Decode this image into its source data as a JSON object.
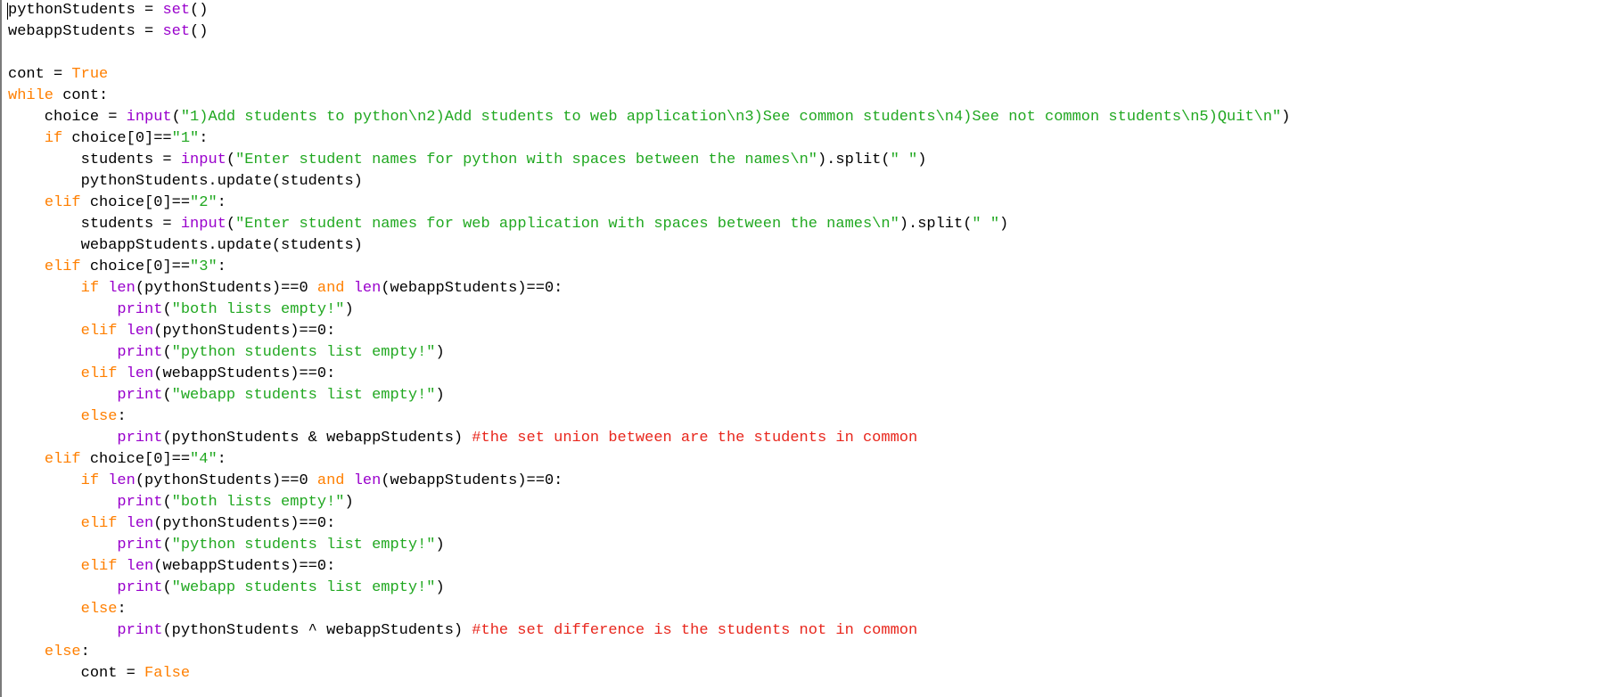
{
  "editor": {
    "colors": {
      "plain": "#000000",
      "keyword": "#ff7f00",
      "builtin": "#9900cc",
      "string": "#21a821",
      "comment": "#e8261c",
      "background": "#ffffff"
    },
    "lines": [
      [
        {
          "t": "pythonStudents = ",
          "k": "plain"
        },
        {
          "t": "set",
          "k": "builtin"
        },
        {
          "t": "()",
          "k": "plain"
        }
      ],
      [
        {
          "t": "webappStudents = ",
          "k": "plain"
        },
        {
          "t": "set",
          "k": "builtin"
        },
        {
          "t": "()",
          "k": "plain"
        }
      ],
      [],
      [
        {
          "t": "cont = ",
          "k": "plain"
        },
        {
          "t": "True",
          "k": "keyword"
        }
      ],
      [
        {
          "t": "while",
          "k": "keyword"
        },
        {
          "t": " cont:",
          "k": "plain"
        }
      ],
      [
        {
          "t": "    choice = ",
          "k": "plain"
        },
        {
          "t": "input",
          "k": "builtin"
        },
        {
          "t": "(",
          "k": "plain"
        },
        {
          "t": "\"1)Add students to python\\n2)Add students to web application\\n3)See common students\\n4)See not common students\\n5)Quit\\n\"",
          "k": "string"
        },
        {
          "t": ")",
          "k": "plain"
        }
      ],
      [
        {
          "t": "    ",
          "k": "plain"
        },
        {
          "t": "if",
          "k": "keyword"
        },
        {
          "t": " choice[0]==",
          "k": "plain"
        },
        {
          "t": "\"1\"",
          "k": "string"
        },
        {
          "t": ":",
          "k": "plain"
        }
      ],
      [
        {
          "t": "        students = ",
          "k": "plain"
        },
        {
          "t": "input",
          "k": "builtin"
        },
        {
          "t": "(",
          "k": "plain"
        },
        {
          "t": "\"Enter student names for python with spaces between the names\\n\"",
          "k": "string"
        },
        {
          "t": ").split(",
          "k": "plain"
        },
        {
          "t": "\" \"",
          "k": "string"
        },
        {
          "t": ")",
          "k": "plain"
        }
      ],
      [
        {
          "t": "        pythonStudents.update(students)",
          "k": "plain"
        }
      ],
      [
        {
          "t": "    ",
          "k": "plain"
        },
        {
          "t": "elif",
          "k": "keyword"
        },
        {
          "t": " choice[0]==",
          "k": "plain"
        },
        {
          "t": "\"2\"",
          "k": "string"
        },
        {
          "t": ":",
          "k": "plain"
        }
      ],
      [
        {
          "t": "        students = ",
          "k": "plain"
        },
        {
          "t": "input",
          "k": "builtin"
        },
        {
          "t": "(",
          "k": "plain"
        },
        {
          "t": "\"Enter student names for web application with spaces between the names\\n\"",
          "k": "string"
        },
        {
          "t": ").split(",
          "k": "plain"
        },
        {
          "t": "\" \"",
          "k": "string"
        },
        {
          "t": ")",
          "k": "plain"
        }
      ],
      [
        {
          "t": "        webappStudents.update(students)",
          "k": "plain"
        }
      ],
      [
        {
          "t": "    ",
          "k": "plain"
        },
        {
          "t": "elif",
          "k": "keyword"
        },
        {
          "t": " choice[0]==",
          "k": "plain"
        },
        {
          "t": "\"3\"",
          "k": "string"
        },
        {
          "t": ":",
          "k": "plain"
        }
      ],
      [
        {
          "t": "        ",
          "k": "plain"
        },
        {
          "t": "if",
          "k": "keyword"
        },
        {
          "t": " ",
          "k": "plain"
        },
        {
          "t": "len",
          "k": "builtin"
        },
        {
          "t": "(pythonStudents)==0 ",
          "k": "plain"
        },
        {
          "t": "and",
          "k": "keyword"
        },
        {
          "t": " ",
          "k": "plain"
        },
        {
          "t": "len",
          "k": "builtin"
        },
        {
          "t": "(webappStudents)==0:",
          "k": "plain"
        }
      ],
      [
        {
          "t": "            ",
          "k": "plain"
        },
        {
          "t": "print",
          "k": "builtin"
        },
        {
          "t": "(",
          "k": "plain"
        },
        {
          "t": "\"both lists empty!\"",
          "k": "string"
        },
        {
          "t": ")",
          "k": "plain"
        }
      ],
      [
        {
          "t": "        ",
          "k": "plain"
        },
        {
          "t": "elif",
          "k": "keyword"
        },
        {
          "t": " ",
          "k": "plain"
        },
        {
          "t": "len",
          "k": "builtin"
        },
        {
          "t": "(pythonStudents)==0:",
          "k": "plain"
        }
      ],
      [
        {
          "t": "            ",
          "k": "plain"
        },
        {
          "t": "print",
          "k": "builtin"
        },
        {
          "t": "(",
          "k": "plain"
        },
        {
          "t": "\"python students list empty!\"",
          "k": "string"
        },
        {
          "t": ")",
          "k": "plain"
        }
      ],
      [
        {
          "t": "        ",
          "k": "plain"
        },
        {
          "t": "elif",
          "k": "keyword"
        },
        {
          "t": " ",
          "k": "plain"
        },
        {
          "t": "len",
          "k": "builtin"
        },
        {
          "t": "(webappStudents)==0:",
          "k": "plain"
        }
      ],
      [
        {
          "t": "            ",
          "k": "plain"
        },
        {
          "t": "print",
          "k": "builtin"
        },
        {
          "t": "(",
          "k": "plain"
        },
        {
          "t": "\"webapp students list empty!\"",
          "k": "string"
        },
        {
          "t": ")",
          "k": "plain"
        }
      ],
      [
        {
          "t": "        ",
          "k": "plain"
        },
        {
          "t": "else",
          "k": "keyword"
        },
        {
          "t": ":",
          "k": "plain"
        }
      ],
      [
        {
          "t": "            ",
          "k": "plain"
        },
        {
          "t": "print",
          "k": "builtin"
        },
        {
          "t": "(pythonStudents & webappStudents) ",
          "k": "plain"
        },
        {
          "t": "#the set union between are the students in common",
          "k": "comment"
        }
      ],
      [
        {
          "t": "    ",
          "k": "plain"
        },
        {
          "t": "elif",
          "k": "keyword"
        },
        {
          "t": " choice[0]==",
          "k": "plain"
        },
        {
          "t": "\"4\"",
          "k": "string"
        },
        {
          "t": ":",
          "k": "plain"
        }
      ],
      [
        {
          "t": "        ",
          "k": "plain"
        },
        {
          "t": "if",
          "k": "keyword"
        },
        {
          "t": " ",
          "k": "plain"
        },
        {
          "t": "len",
          "k": "builtin"
        },
        {
          "t": "(pythonStudents)==0 ",
          "k": "plain"
        },
        {
          "t": "and",
          "k": "keyword"
        },
        {
          "t": " ",
          "k": "plain"
        },
        {
          "t": "len",
          "k": "builtin"
        },
        {
          "t": "(webappStudents)==0:",
          "k": "plain"
        }
      ],
      [
        {
          "t": "            ",
          "k": "plain"
        },
        {
          "t": "print",
          "k": "builtin"
        },
        {
          "t": "(",
          "k": "plain"
        },
        {
          "t": "\"both lists empty!\"",
          "k": "string"
        },
        {
          "t": ")",
          "k": "plain"
        }
      ],
      [
        {
          "t": "        ",
          "k": "plain"
        },
        {
          "t": "elif",
          "k": "keyword"
        },
        {
          "t": " ",
          "k": "plain"
        },
        {
          "t": "len",
          "k": "builtin"
        },
        {
          "t": "(pythonStudents)==0:",
          "k": "plain"
        }
      ],
      [
        {
          "t": "            ",
          "k": "plain"
        },
        {
          "t": "print",
          "k": "builtin"
        },
        {
          "t": "(",
          "k": "plain"
        },
        {
          "t": "\"python students list empty!\"",
          "k": "string"
        },
        {
          "t": ")",
          "k": "plain"
        }
      ],
      [
        {
          "t": "        ",
          "k": "plain"
        },
        {
          "t": "elif",
          "k": "keyword"
        },
        {
          "t": " ",
          "k": "plain"
        },
        {
          "t": "len",
          "k": "builtin"
        },
        {
          "t": "(webappStudents)==0:",
          "k": "plain"
        }
      ],
      [
        {
          "t": "            ",
          "k": "plain"
        },
        {
          "t": "print",
          "k": "builtin"
        },
        {
          "t": "(",
          "k": "plain"
        },
        {
          "t": "\"webapp students list empty!\"",
          "k": "string"
        },
        {
          "t": ")",
          "k": "plain"
        }
      ],
      [
        {
          "t": "        ",
          "k": "plain"
        },
        {
          "t": "else",
          "k": "keyword"
        },
        {
          "t": ":",
          "k": "plain"
        }
      ],
      [
        {
          "t": "            ",
          "k": "plain"
        },
        {
          "t": "print",
          "k": "builtin"
        },
        {
          "t": "(pythonStudents ^ webappStudents) ",
          "k": "plain"
        },
        {
          "t": "#the set difference is the students not in common",
          "k": "comment"
        }
      ],
      [
        {
          "t": "    ",
          "k": "plain"
        },
        {
          "t": "else",
          "k": "keyword"
        },
        {
          "t": ":",
          "k": "plain"
        }
      ],
      [
        {
          "t": "        cont = ",
          "k": "plain"
        },
        {
          "t": "False",
          "k": "keyword"
        }
      ]
    ]
  }
}
